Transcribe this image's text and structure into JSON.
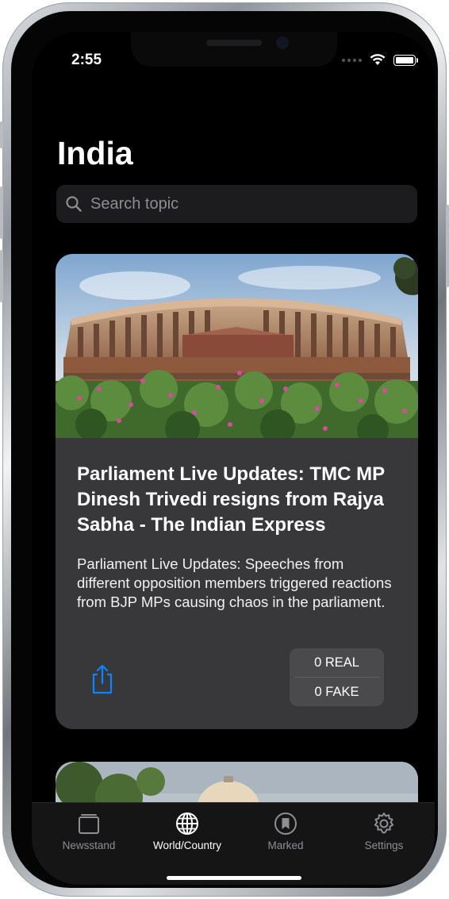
{
  "status_bar": {
    "time": "2:55"
  },
  "header": {
    "title": "India"
  },
  "search": {
    "placeholder": "Search topic"
  },
  "articles": [
    {
      "title": "Parliament Live Updates: TMC MP Dinesh Trivedi resigns from Rajya Sabha - The Indian Express",
      "description": "Parliament Live Updates:  Speeches from different opposition members triggered reactions from BJP MPs causing chaos in the parliament.",
      "real_label": "0 REAL",
      "fake_label": "0 FAKE",
      "share_icon": "share-icon"
    }
  ],
  "tab_bar": {
    "items": [
      {
        "label": "Newsstand",
        "icon": "newsstand-icon"
      },
      {
        "label": "World/Country",
        "icon": "globe-icon",
        "active": true
      },
      {
        "label": "Marked",
        "icon": "bookmark-icon"
      },
      {
        "label": "Settings",
        "icon": "gear-icon"
      }
    ]
  },
  "colors": {
    "accent": "#0a84ff",
    "background": "#000000",
    "card": "#38383a",
    "tabbar": "#151516"
  }
}
